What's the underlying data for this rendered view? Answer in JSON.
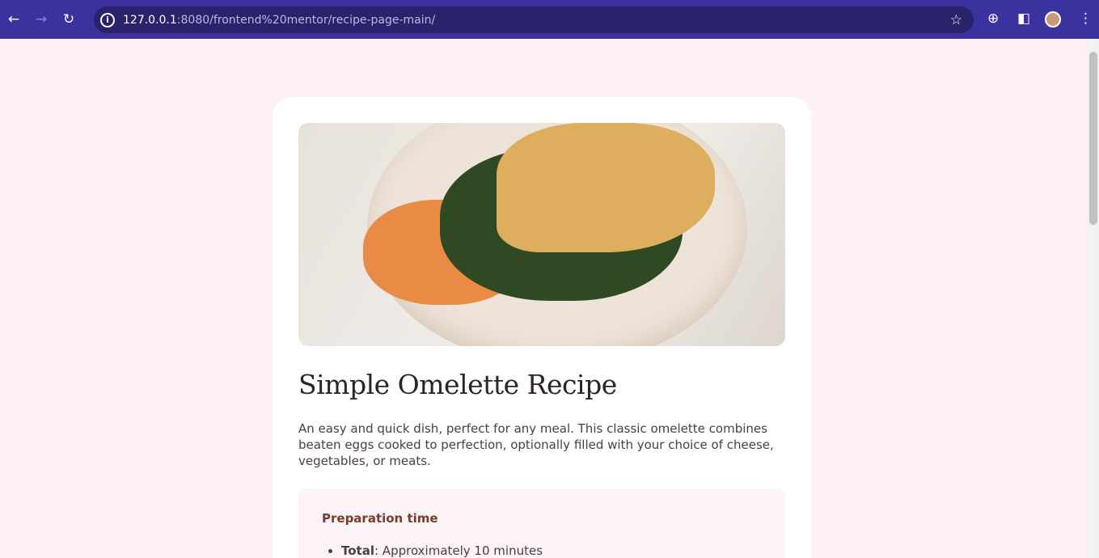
{
  "browser": {
    "url_host": "127.0.0.1",
    "url_rest": ":8080/frontend%20mentor/recipe-page-main/"
  },
  "recipe": {
    "title": "Simple Omelette Recipe",
    "description": "An easy and quick dish, perfect for any meal. This classic omelette combines beaten eggs cooked to perfection, optionally filled with your choice of cheese, vegetables, or meats.",
    "prep": {
      "heading": "Preparation time",
      "items": [
        {
          "label": "Total",
          "value": ": Approximately 10 minutes"
        }
      ]
    }
  }
}
